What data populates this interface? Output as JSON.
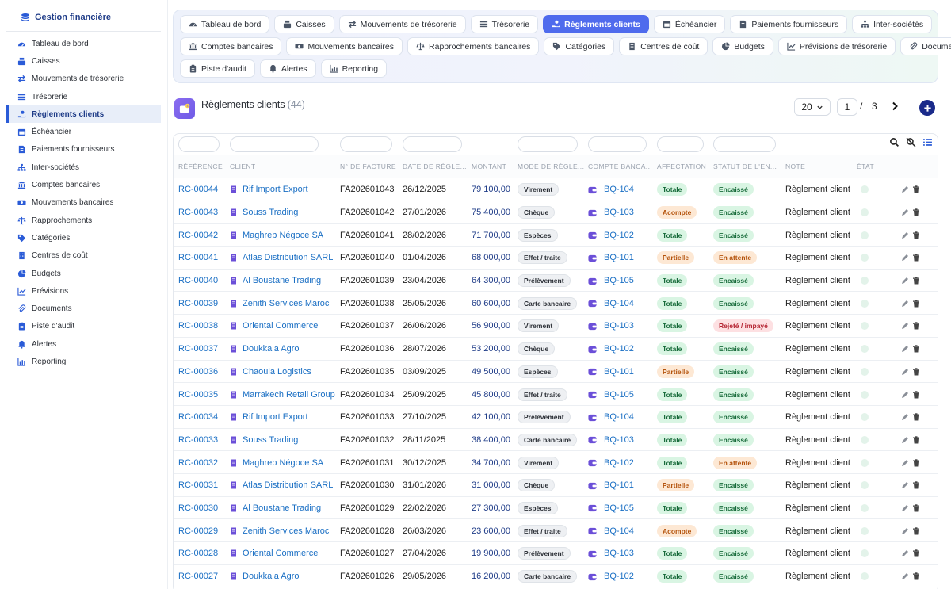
{
  "app": {
    "title": "Gestion financière"
  },
  "sidebar": {
    "items": [
      {
        "label": "Tableau de bord",
        "icon": "gauge-icon"
      },
      {
        "label": "Caisses",
        "icon": "cash-register-icon"
      },
      {
        "label": "Mouvements de trésorerie",
        "icon": "swap-icon"
      },
      {
        "label": "Trésorerie",
        "icon": "list-icon"
      },
      {
        "label": "Règlements clients",
        "icon": "hand-money-icon",
        "active": true
      },
      {
        "label": "Échéancier",
        "icon": "calendar-icon"
      },
      {
        "label": "Paiements fournisseurs",
        "icon": "invoice-icon"
      },
      {
        "label": "Inter-sociétés",
        "icon": "sitemap-icon"
      },
      {
        "label": "Comptes bancaires",
        "icon": "bank-icon"
      },
      {
        "label": "Mouvements bancaires",
        "icon": "money-bill-icon"
      },
      {
        "label": "Rapprochements",
        "icon": "scale-icon"
      },
      {
        "label": "Catégories",
        "icon": "tags-icon"
      },
      {
        "label": "Centres de coût",
        "icon": "building-icon"
      },
      {
        "label": "Budgets",
        "icon": "pie-icon"
      },
      {
        "label": "Prévisions",
        "icon": "trend-icon"
      },
      {
        "label": "Documents",
        "icon": "paperclip-icon"
      },
      {
        "label": "Piste d'audit",
        "icon": "clipboard-icon"
      },
      {
        "label": "Alertes",
        "icon": "bell-icon"
      },
      {
        "label": "Reporting",
        "icon": "chart-icon"
      }
    ]
  },
  "tabs": {
    "rows": [
      [
        {
          "label": "Tableau de bord",
          "icon": "gauge-icon"
        },
        {
          "label": "Caisses",
          "icon": "cash-register-icon"
        },
        {
          "label": "Mouvements de trésorerie",
          "icon": "swap-icon"
        },
        {
          "label": "Trésorerie",
          "icon": "list-icon"
        },
        {
          "label": "Règlements clients",
          "icon": "hand-money-icon",
          "active": true
        },
        {
          "label": "Échéancier",
          "icon": "calendar-icon"
        },
        {
          "label": "Paiements fournisseurs",
          "icon": "invoice-icon"
        },
        {
          "label": "Inter-sociétés",
          "icon": "sitemap-icon"
        }
      ],
      [
        {
          "label": "Comptes bancaires",
          "icon": "bank-icon"
        },
        {
          "label": "Mouvements bancaires",
          "icon": "money-bill-icon"
        },
        {
          "label": "Rapprochements bancaires",
          "icon": "scale-icon"
        },
        {
          "label": "Catégories",
          "icon": "tags-icon"
        },
        {
          "label": "Centres de coût",
          "icon": "building-icon"
        },
        {
          "label": "Budgets",
          "icon": "pie-icon"
        },
        {
          "label": "Prévisions de trésorerie",
          "icon": "trend-icon"
        },
        {
          "label": "Documents",
          "icon": "paperclip-icon"
        }
      ],
      [
        {
          "label": "Piste d'audit",
          "icon": "clipboard-icon"
        },
        {
          "label": "Alertes",
          "icon": "bell-icon"
        },
        {
          "label": "Reporting",
          "icon": "chart-icon"
        }
      ]
    ]
  },
  "header": {
    "title": "Règlements clients",
    "count": "(44)"
  },
  "pagination": {
    "per_page": "20",
    "page": "1",
    "separator": "/",
    "total_pages": "3"
  },
  "table": {
    "columns": [
      "RÉFÉRENCE",
      "CLIENT",
      "N° DE FACTURE",
      "DATE DE RÈGLE...",
      "MONTANT",
      "MODE DE RÈGLE...",
      "COMPTE BANCA...",
      "AFFECTATION",
      "STATUT DE L'EN...",
      "NOTE",
      "ÉTAT"
    ],
    "rows": [
      {
        "ref": "RC-00044",
        "client": "Rif Import Export",
        "facture": "FA202601043",
        "date": "26/12/2025",
        "montant": "79 100,00",
        "mode": "Virement",
        "compte": "BQ-104",
        "affectation": "Totale",
        "statut": "Encaissé",
        "note": "Règlement client"
      },
      {
        "ref": "RC-00043",
        "client": "Souss Trading",
        "facture": "FA202601042",
        "date": "27/01/2026",
        "montant": "75 400,00",
        "mode": "Chèque",
        "compte": "BQ-103",
        "affectation": "Acompte",
        "statut": "Encaissé",
        "note": "Règlement client"
      },
      {
        "ref": "RC-00042",
        "client": "Maghreb Négoce SA",
        "facture": "FA202601041",
        "date": "28/02/2026",
        "montant": "71 700,00",
        "mode": "Espèces",
        "compte": "BQ-102",
        "affectation": "Totale",
        "statut": "Encaissé",
        "note": "Règlement client"
      },
      {
        "ref": "RC-00041",
        "client": "Atlas Distribution SARL",
        "facture": "FA202601040",
        "date": "01/04/2026",
        "montant": "68 000,00",
        "mode": "Effet / traite",
        "compte": "BQ-101",
        "affectation": "Partielle",
        "statut": "En attente",
        "note": "Règlement client"
      },
      {
        "ref": "RC-00040",
        "client": "Al Boustane Trading",
        "facture": "FA202601039",
        "date": "23/04/2026",
        "montant": "64 300,00",
        "mode": "Prélèvement",
        "compte": "BQ-105",
        "affectation": "Totale",
        "statut": "Encaissé",
        "note": "Règlement client"
      },
      {
        "ref": "RC-00039",
        "client": "Zenith Services Maroc",
        "facture": "FA202601038",
        "date": "25/05/2026",
        "montant": "60 600,00",
        "mode": "Carte bancaire",
        "compte": "BQ-104",
        "affectation": "Totale",
        "statut": "Encaissé",
        "note": "Règlement client"
      },
      {
        "ref": "RC-00038",
        "client": "Oriental Commerce",
        "facture": "FA202601037",
        "date": "26/06/2026",
        "montant": "56 900,00",
        "mode": "Virement",
        "compte": "BQ-103",
        "affectation": "Totale",
        "statut": "Rejeté / impayé",
        "note": "Règlement client"
      },
      {
        "ref": "RC-00037",
        "client": "Doukkala Agro",
        "facture": "FA202601036",
        "date": "28/07/2026",
        "montant": "53 200,00",
        "mode": "Chèque",
        "compte": "BQ-102",
        "affectation": "Totale",
        "statut": "Encaissé",
        "note": "Règlement client"
      },
      {
        "ref": "RC-00036",
        "client": "Chaouia Logistics",
        "facture": "FA202601035",
        "date": "03/09/2025",
        "montant": "49 500,00",
        "mode": "Espèces",
        "compte": "BQ-101",
        "affectation": "Partielle",
        "statut": "Encaissé",
        "note": "Règlement client"
      },
      {
        "ref": "RC-00035",
        "client": "Marrakech Retail Group",
        "facture": "FA202601034",
        "date": "25/09/2025",
        "montant": "45 800,00",
        "mode": "Effet / traite",
        "compte": "BQ-105",
        "affectation": "Totale",
        "statut": "Encaissé",
        "note": "Règlement client"
      },
      {
        "ref": "RC-00034",
        "client": "Rif Import Export",
        "facture": "FA202601033",
        "date": "27/10/2025",
        "montant": "42 100,00",
        "mode": "Prélèvement",
        "compte": "BQ-104",
        "affectation": "Totale",
        "statut": "Encaissé",
        "note": "Règlement client"
      },
      {
        "ref": "RC-00033",
        "client": "Souss Trading",
        "facture": "FA202601032",
        "date": "28/11/2025",
        "montant": "38 400,00",
        "mode": "Carte bancaire",
        "compte": "BQ-103",
        "affectation": "Totale",
        "statut": "Encaissé",
        "note": "Règlement client"
      },
      {
        "ref": "RC-00032",
        "client": "Maghreb Négoce SA",
        "facture": "FA202601031",
        "date": "30/12/2025",
        "montant": "34 700,00",
        "mode": "Virement",
        "compte": "BQ-102",
        "affectation": "Totale",
        "statut": "En attente",
        "note": "Règlement client"
      },
      {
        "ref": "RC-00031",
        "client": "Atlas Distribution SARL",
        "facture": "FA202601030",
        "date": "31/01/2026",
        "montant": "31 000,00",
        "mode": "Chèque",
        "compte": "BQ-101",
        "affectation": "Partielle",
        "statut": "Encaissé",
        "note": "Règlement client"
      },
      {
        "ref": "RC-00030",
        "client": "Al Boustane Trading",
        "facture": "FA202601029",
        "date": "22/02/2026",
        "montant": "27 300,00",
        "mode": "Espèces",
        "compte": "BQ-105",
        "affectation": "Totale",
        "statut": "Encaissé",
        "note": "Règlement client"
      },
      {
        "ref": "RC-00029",
        "client": "Zenith Services Maroc",
        "facture": "FA202601028",
        "date": "26/03/2026",
        "montant": "23 600,00",
        "mode": "Effet / traite",
        "compte": "BQ-104",
        "affectation": "Acompte",
        "statut": "Encaissé",
        "note": "Règlement client"
      },
      {
        "ref": "RC-00028",
        "client": "Oriental Commerce",
        "facture": "FA202601027",
        "date": "27/04/2026",
        "montant": "19 900,00",
        "mode": "Prélèvement",
        "compte": "BQ-103",
        "affectation": "Totale",
        "statut": "Encaissé",
        "note": "Règlement client"
      },
      {
        "ref": "RC-00027",
        "client": "Doukkala Agro",
        "facture": "FA202601026",
        "date": "29/05/2026",
        "montant": "16 200,00",
        "mode": "Carte bancaire",
        "compte": "BQ-102",
        "affectation": "Totale",
        "statut": "Encaissé",
        "note": "Règlement client"
      }
    ]
  },
  "colors": {
    "accent": "#4f6bed",
    "link": "#1a6fc4",
    "success_bg": "#d9f5e3",
    "warning_bg": "#fde8d4",
    "danger_bg": "#fde0e2"
  }
}
